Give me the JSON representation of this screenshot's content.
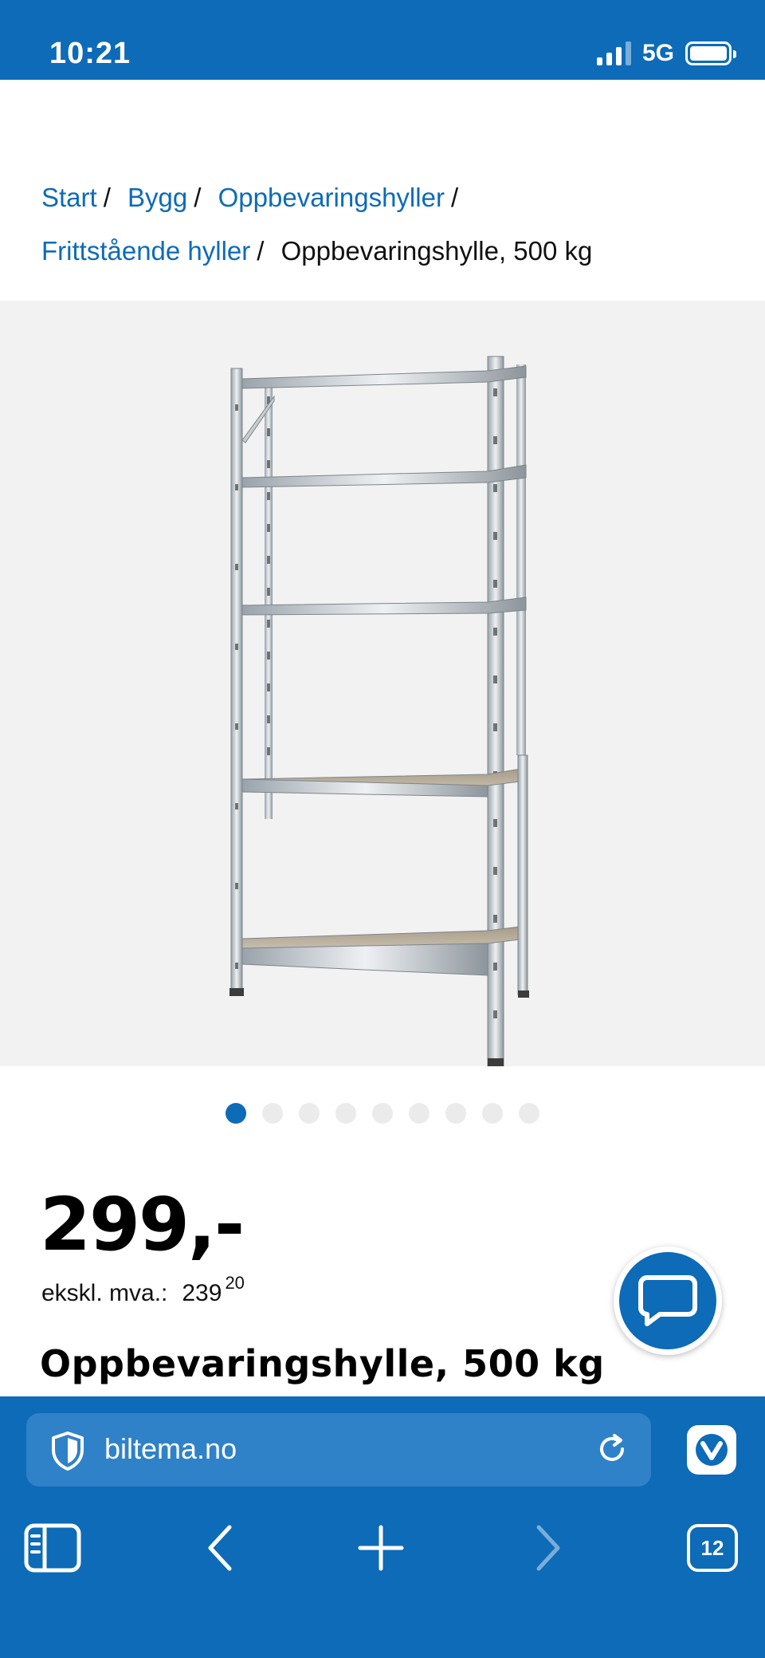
{
  "status_bar": {
    "time": "10:21",
    "network": "5G"
  },
  "breadcrumb": {
    "items": [
      "Start",
      "Bygg",
      "Oppbevaringshyller",
      "Frittstående hyller"
    ],
    "current": "Oppbevaringshylle, 500 kg",
    "separator": "/"
  },
  "gallery": {
    "image_alt": "shelving-unit-icon",
    "dot_count": 9,
    "active_index": 0
  },
  "product": {
    "price": "299,-",
    "vat_label": "ekskl. mva.:",
    "vat_value_main": "239",
    "vat_value_decimals": "20",
    "title": "Oppbevaringshylle, 500 kg"
  },
  "browser": {
    "url": "biltema.no",
    "tab_count": "12"
  },
  "colors": {
    "brand_blue": "#0d6bb8",
    "url_box": "#2f82c8",
    "image_bg": "#f2f2f2"
  }
}
